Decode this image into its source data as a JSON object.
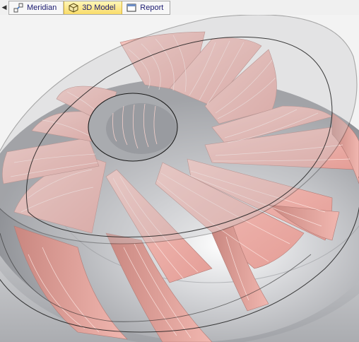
{
  "tabs": [
    {
      "label": "Meridian",
      "icon": "meridian-icon",
      "active": false
    },
    {
      "label": "3D Model",
      "icon": "cube-icon",
      "active": true
    },
    {
      "label": "Report",
      "icon": "window-icon",
      "active": false
    }
  ],
  "colors": {
    "blade": "#f0b4ae",
    "blade_line": "#fbe6e2",
    "hub": "#b9bbc0",
    "shroud": "#d2d3d6",
    "tab_text": "#1a1a70",
    "active_tab": "#f9dc6a"
  }
}
